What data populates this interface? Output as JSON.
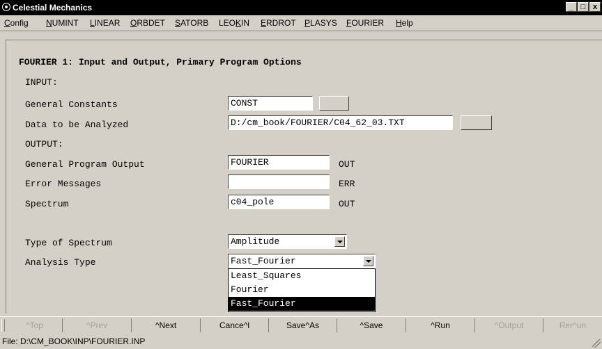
{
  "window": {
    "title": "Celestial Mechanics",
    "controls": [
      "_",
      "□",
      "x"
    ]
  },
  "menu": [
    {
      "label": "Config",
      "ul": "C",
      "rest": "onfig"
    },
    {
      "label": "NUMINT",
      "ul": "N",
      "rest": "UMINT"
    },
    {
      "label": "LINEAR",
      "ul": "L",
      "rest": "INEAR"
    },
    {
      "label": "ORBDET",
      "ul": "O",
      "rest": "RBDET"
    },
    {
      "label": "SATORB",
      "ul": "S",
      "rest": "ATORB"
    },
    {
      "label": "LEOKIN",
      "pre": "LEO",
      "ul": "K",
      "rest": "IN"
    },
    {
      "label": "ERDROT",
      "ul": "E",
      "rest": "RDROT"
    },
    {
      "label": "PLASYS",
      "ul": "P",
      "rest": "LASYS"
    },
    {
      "label": "FOURIER",
      "ul": "F",
      "rest": "OURIER"
    },
    {
      "label": "Help",
      "ul": "H",
      "rest": "elp"
    }
  ],
  "form": {
    "heading": "FOURIER 1: Input and Output, Primary Program Options",
    "input_section": "INPUT:",
    "general_constants": {
      "label": "General Constants",
      "value": "CONST"
    },
    "data_to_analyze": {
      "label": "Data to be Analyzed",
      "value": "D:/cm_book/FOURIER/C04_62_03.TXT"
    },
    "output_section": "OUTPUT:",
    "general_output": {
      "label": "General Program Output",
      "value": "FOURIER",
      "ext": "OUT"
    },
    "error_messages": {
      "label": "Error Messages",
      "value": "",
      "ext": "ERR"
    },
    "spectrum": {
      "label": "Spectrum",
      "value": "c04_pole",
      "ext": "OUT"
    },
    "spectrum_type": {
      "label": "Type of Spectrum",
      "value": "Amplitude"
    },
    "analysis_type": {
      "label": "Analysis Type",
      "value": "Fast_Fourier",
      "options": [
        "Least_Squares",
        "Fourier",
        "Fast_Fourier"
      ],
      "selected_index": 2
    }
  },
  "toolbar": [
    {
      "label": "^Top",
      "enabled": false
    },
    {
      "label": "^Prev",
      "enabled": false
    },
    {
      "label": "^Next",
      "enabled": true
    },
    {
      "label": "Cance^l",
      "enabled": true
    },
    {
      "label": "Save^As",
      "enabled": true
    },
    {
      "label": "^Save",
      "enabled": true
    },
    {
      "label": "^Run",
      "enabled": true
    },
    {
      "label": "^Output",
      "enabled": false
    },
    {
      "label": "Rer^un",
      "enabled": false
    }
  ],
  "status": {
    "file": "File: D:\\CM_BOOK\\INP\\FOURIER.INP"
  }
}
